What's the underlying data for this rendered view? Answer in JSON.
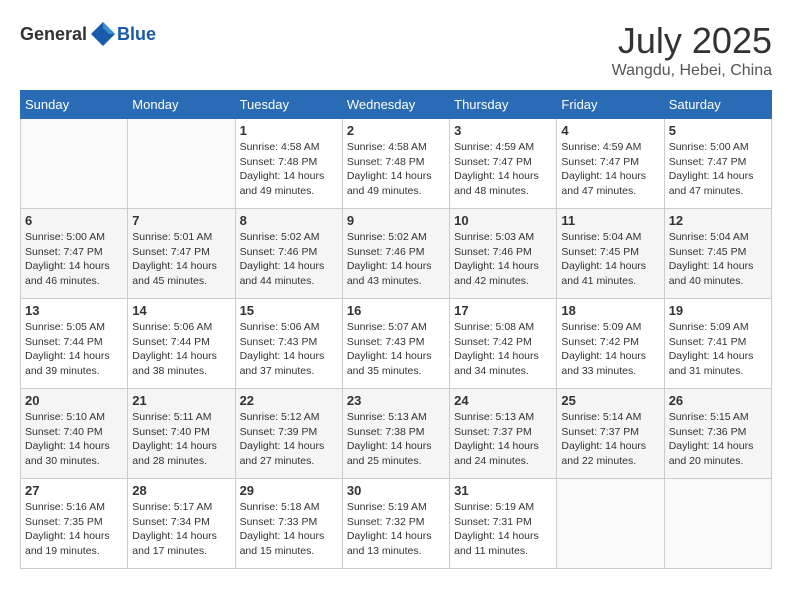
{
  "header": {
    "logo_general": "General",
    "logo_blue": "Blue",
    "month_year": "July 2025",
    "location": "Wangdu, Hebei, China"
  },
  "weekdays": [
    "Sunday",
    "Monday",
    "Tuesday",
    "Wednesday",
    "Thursday",
    "Friday",
    "Saturday"
  ],
  "weeks": [
    [
      {
        "day": "",
        "info": ""
      },
      {
        "day": "",
        "info": ""
      },
      {
        "day": "1",
        "sunrise": "Sunrise: 4:58 AM",
        "sunset": "Sunset: 7:48 PM",
        "daylight": "Daylight: 14 hours and 49 minutes."
      },
      {
        "day": "2",
        "sunrise": "Sunrise: 4:58 AM",
        "sunset": "Sunset: 7:48 PM",
        "daylight": "Daylight: 14 hours and 49 minutes."
      },
      {
        "day": "3",
        "sunrise": "Sunrise: 4:59 AM",
        "sunset": "Sunset: 7:47 PM",
        "daylight": "Daylight: 14 hours and 48 minutes."
      },
      {
        "day": "4",
        "sunrise": "Sunrise: 4:59 AM",
        "sunset": "Sunset: 7:47 PM",
        "daylight": "Daylight: 14 hours and 47 minutes."
      },
      {
        "day": "5",
        "sunrise": "Sunrise: 5:00 AM",
        "sunset": "Sunset: 7:47 PM",
        "daylight": "Daylight: 14 hours and 47 minutes."
      }
    ],
    [
      {
        "day": "6",
        "sunrise": "Sunrise: 5:00 AM",
        "sunset": "Sunset: 7:47 PM",
        "daylight": "Daylight: 14 hours and 46 minutes."
      },
      {
        "day": "7",
        "sunrise": "Sunrise: 5:01 AM",
        "sunset": "Sunset: 7:47 PM",
        "daylight": "Daylight: 14 hours and 45 minutes."
      },
      {
        "day": "8",
        "sunrise": "Sunrise: 5:02 AM",
        "sunset": "Sunset: 7:46 PM",
        "daylight": "Daylight: 14 hours and 44 minutes."
      },
      {
        "day": "9",
        "sunrise": "Sunrise: 5:02 AM",
        "sunset": "Sunset: 7:46 PM",
        "daylight": "Daylight: 14 hours and 43 minutes."
      },
      {
        "day": "10",
        "sunrise": "Sunrise: 5:03 AM",
        "sunset": "Sunset: 7:46 PM",
        "daylight": "Daylight: 14 hours and 42 minutes."
      },
      {
        "day": "11",
        "sunrise": "Sunrise: 5:04 AM",
        "sunset": "Sunset: 7:45 PM",
        "daylight": "Daylight: 14 hours and 41 minutes."
      },
      {
        "day": "12",
        "sunrise": "Sunrise: 5:04 AM",
        "sunset": "Sunset: 7:45 PM",
        "daylight": "Daylight: 14 hours and 40 minutes."
      }
    ],
    [
      {
        "day": "13",
        "sunrise": "Sunrise: 5:05 AM",
        "sunset": "Sunset: 7:44 PM",
        "daylight": "Daylight: 14 hours and 39 minutes."
      },
      {
        "day": "14",
        "sunrise": "Sunrise: 5:06 AM",
        "sunset": "Sunset: 7:44 PM",
        "daylight": "Daylight: 14 hours and 38 minutes."
      },
      {
        "day": "15",
        "sunrise": "Sunrise: 5:06 AM",
        "sunset": "Sunset: 7:43 PM",
        "daylight": "Daylight: 14 hours and 37 minutes."
      },
      {
        "day": "16",
        "sunrise": "Sunrise: 5:07 AM",
        "sunset": "Sunset: 7:43 PM",
        "daylight": "Daylight: 14 hours and 35 minutes."
      },
      {
        "day": "17",
        "sunrise": "Sunrise: 5:08 AM",
        "sunset": "Sunset: 7:42 PM",
        "daylight": "Daylight: 14 hours and 34 minutes."
      },
      {
        "day": "18",
        "sunrise": "Sunrise: 5:09 AM",
        "sunset": "Sunset: 7:42 PM",
        "daylight": "Daylight: 14 hours and 33 minutes."
      },
      {
        "day": "19",
        "sunrise": "Sunrise: 5:09 AM",
        "sunset": "Sunset: 7:41 PM",
        "daylight": "Daylight: 14 hours and 31 minutes."
      }
    ],
    [
      {
        "day": "20",
        "sunrise": "Sunrise: 5:10 AM",
        "sunset": "Sunset: 7:40 PM",
        "daylight": "Daylight: 14 hours and 30 minutes."
      },
      {
        "day": "21",
        "sunrise": "Sunrise: 5:11 AM",
        "sunset": "Sunset: 7:40 PM",
        "daylight": "Daylight: 14 hours and 28 minutes."
      },
      {
        "day": "22",
        "sunrise": "Sunrise: 5:12 AM",
        "sunset": "Sunset: 7:39 PM",
        "daylight": "Daylight: 14 hours and 27 minutes."
      },
      {
        "day": "23",
        "sunrise": "Sunrise: 5:13 AM",
        "sunset": "Sunset: 7:38 PM",
        "daylight": "Daylight: 14 hours and 25 minutes."
      },
      {
        "day": "24",
        "sunrise": "Sunrise: 5:13 AM",
        "sunset": "Sunset: 7:37 PM",
        "daylight": "Daylight: 14 hours and 24 minutes."
      },
      {
        "day": "25",
        "sunrise": "Sunrise: 5:14 AM",
        "sunset": "Sunset: 7:37 PM",
        "daylight": "Daylight: 14 hours and 22 minutes."
      },
      {
        "day": "26",
        "sunrise": "Sunrise: 5:15 AM",
        "sunset": "Sunset: 7:36 PM",
        "daylight": "Daylight: 14 hours and 20 minutes."
      }
    ],
    [
      {
        "day": "27",
        "sunrise": "Sunrise: 5:16 AM",
        "sunset": "Sunset: 7:35 PM",
        "daylight": "Daylight: 14 hours and 19 minutes."
      },
      {
        "day": "28",
        "sunrise": "Sunrise: 5:17 AM",
        "sunset": "Sunset: 7:34 PM",
        "daylight": "Daylight: 14 hours and 17 minutes."
      },
      {
        "day": "29",
        "sunrise": "Sunrise: 5:18 AM",
        "sunset": "Sunset: 7:33 PM",
        "daylight": "Daylight: 14 hours and 15 minutes."
      },
      {
        "day": "30",
        "sunrise": "Sunrise: 5:19 AM",
        "sunset": "Sunset: 7:32 PM",
        "daylight": "Daylight: 14 hours and 13 minutes."
      },
      {
        "day": "31",
        "sunrise": "Sunrise: 5:19 AM",
        "sunset": "Sunset: 7:31 PM",
        "daylight": "Daylight: 14 hours and 11 minutes."
      },
      {
        "day": "",
        "info": ""
      },
      {
        "day": "",
        "info": ""
      }
    ]
  ]
}
